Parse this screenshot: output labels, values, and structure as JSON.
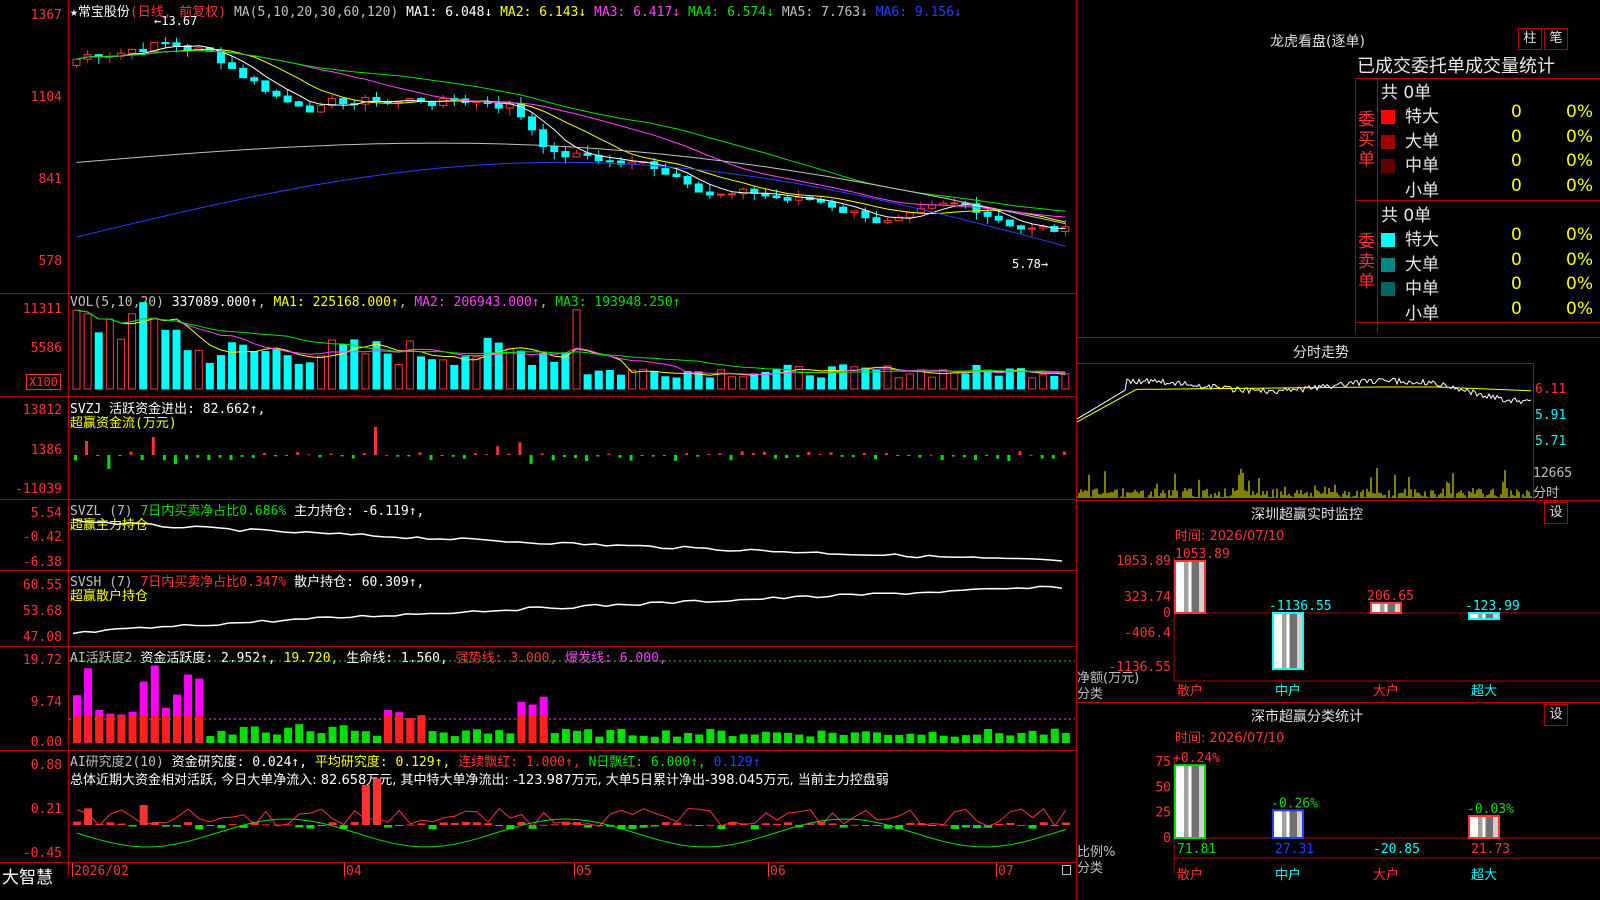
{
  "colors": {
    "up": "#ff3232",
    "down": "#00ffff",
    "grid": "#b40000",
    "ma1": "#ffffff",
    "ma2": "#ffff00",
    "ma3": "#ff40ff",
    "ma4": "#00e000",
    "ma5": "#c0c0c0",
    "ma6": "#2040ff"
  },
  "main": {
    "header_symbol": "★常宝股份",
    "header_period": "(日线, 前复权)",
    "header_ma": "MA(5,10,20,30,60,120)",
    "ma1": "MA1: 6.048↓",
    "ma2": "MA2: 6.143↓",
    "ma3": "MA3: 6.417↓",
    "ma4": "MA4: 6.574↓",
    "ma5": "MA5: 7.763↓",
    "ma6": "MA6: 9.156↓",
    "ylabels": [
      "1367",
      "1104",
      "841",
      "578"
    ],
    "high_label": "13.67",
    "low_label": "5.78"
  },
  "vol": {
    "title": "VOL(5,10,20)",
    "value": "337089.000↑",
    "ma1": "MA1: 225168.000↑",
    "ma2": "MA2: 206943.000↑",
    "ma3": "MA3: 193948.250↑",
    "ylabels": [
      "11311",
      "5586"
    ],
    "unit": "X100"
  },
  "svzj": {
    "title": "SVZJ  活跃资金进出: 82.662↑,",
    "subtitle": "超赢资金流(万元)",
    "ylabels": [
      "13812",
      "1386",
      "-11039"
    ]
  },
  "svzl": {
    "title": "SVZL (7)",
    "t2": "7日内买卖净占比0.686%",
    "t3": "主力持仓: -6.119↑,",
    "subtitle": "超赢主力持仓",
    "ylabels": [
      "5.54",
      "-0.42",
      "-6.38"
    ]
  },
  "svsh": {
    "title": "SVSH (7)",
    "t2": "7日内买卖净占比0.347%",
    "t3": "散户持仓: 60.309↑,",
    "subtitle": "超赢散户持仓",
    "ylabels": [
      "60.55",
      "53.68",
      "47.08"
    ]
  },
  "ai1": {
    "title": "AI活跃度2",
    "t2": "资金活跃度: 2.952↑,",
    "t3": "19.720,",
    "t4": "生命线: 1.560,",
    "t5": "强势线: 3.000,",
    "t6": "爆发线: 6.000,",
    "ylabels": [
      "19.72",
      "9.74",
      "0.00"
    ]
  },
  "ai2": {
    "title": "AI研究度2(10)",
    "t2": "资金研究度: 0.024↑,",
    "t3": "平均研究度: 0.129↑,",
    "t4": "连续飘红: 1.000↑,",
    "t5": "N日飘红: 6.000↑,",
    "t6": "0.129↑",
    "summary": "总体近期大资金相对活跃, 今日大单净流入: 82.658万元, 其中特大单净流出: -123.987万元, 大单5日累计净出-398.045万元, 当前主力控盘弱",
    "ylabels": [
      "0.88",
      "0.21",
      "-0.45"
    ]
  },
  "xaxis": {
    "app": "大智慧",
    "labels": [
      "2026/02",
      "04",
      "05",
      "06",
      "07"
    ]
  },
  "lhb": {
    "title": "龙虎看盘(逐单)",
    "btn1": "柱",
    "btn2": "笔",
    "header": "已成交委托单成交量统计",
    "buy_total": "共 0单",
    "sell_total": "共 0单",
    "buy_label": "委买单",
    "sell_label": "委卖单",
    "buy_rows": [
      {
        "name": "特大",
        "count": "0",
        "pct": "0%",
        "color": "#ff0000"
      },
      {
        "name": "大单",
        "count": "0",
        "pct": "0%",
        "color": "#a00000"
      },
      {
        "name": "中单",
        "count": "0",
        "pct": "0%",
        "color": "#600000"
      },
      {
        "name": "小单",
        "count": "0",
        "pct": "0%",
        "color": "#000000"
      }
    ],
    "sell_rows": [
      {
        "name": "特大",
        "count": "0",
        "pct": "0%",
        "color": "#00ffff"
      },
      {
        "name": "大单",
        "count": "0",
        "pct": "0%",
        "color": "#008888"
      },
      {
        "name": "中单",
        "count": "0",
        "pct": "0%",
        "color": "#006666"
      },
      {
        "name": "小单",
        "count": "0",
        "pct": "0%",
        "color": "#000000"
      }
    ]
  },
  "intraday": {
    "title": "分时走势",
    "ylabels": [
      "6.11",
      "5.91",
      "5.71"
    ],
    "vol_label": "12665",
    "vol_caption": "分时"
  },
  "monitor": {
    "title": "深圳超赢实时监控",
    "btn": "设",
    "time": "时间: 2026/07/10",
    "ylabels": [
      "1053.89",
      "323.74",
      "0",
      "-406.4",
      "-1136.55"
    ],
    "caption1": "净额(万元)",
    "caption2": "分类",
    "bars": [
      {
        "cat": "散户",
        "value": 1053.89,
        "label": "1053.89"
      },
      {
        "cat": "中户",
        "value": -1136.55,
        "label": "-1136.55"
      },
      {
        "cat": "大户",
        "value": 206.65,
        "label": "206.65"
      },
      {
        "cat": "超大",
        "value": -123.99,
        "label": "-123.99"
      }
    ]
  },
  "classify": {
    "title": "深市超赢分类统计",
    "btn": "设",
    "time": "时间: 2026/07/10",
    "ylabels": [
      "75",
      "50",
      "25",
      "0"
    ],
    "caption1": "比例%",
    "caption2": "分类",
    "bars": [
      {
        "cat": "散户",
        "value": 71.81,
        "label": "71.81",
        "change": "+0.24%"
      },
      {
        "cat": "中户",
        "value": 27.31,
        "label": "27.31",
        "change": "-0.26%"
      },
      {
        "cat": "大户",
        "value": -20.85,
        "label": "-20.85",
        "change": ""
      },
      {
        "cat": "超大",
        "value": 21.73,
        "label": "21.73",
        "change": "-0.03%"
      }
    ]
  }
}
